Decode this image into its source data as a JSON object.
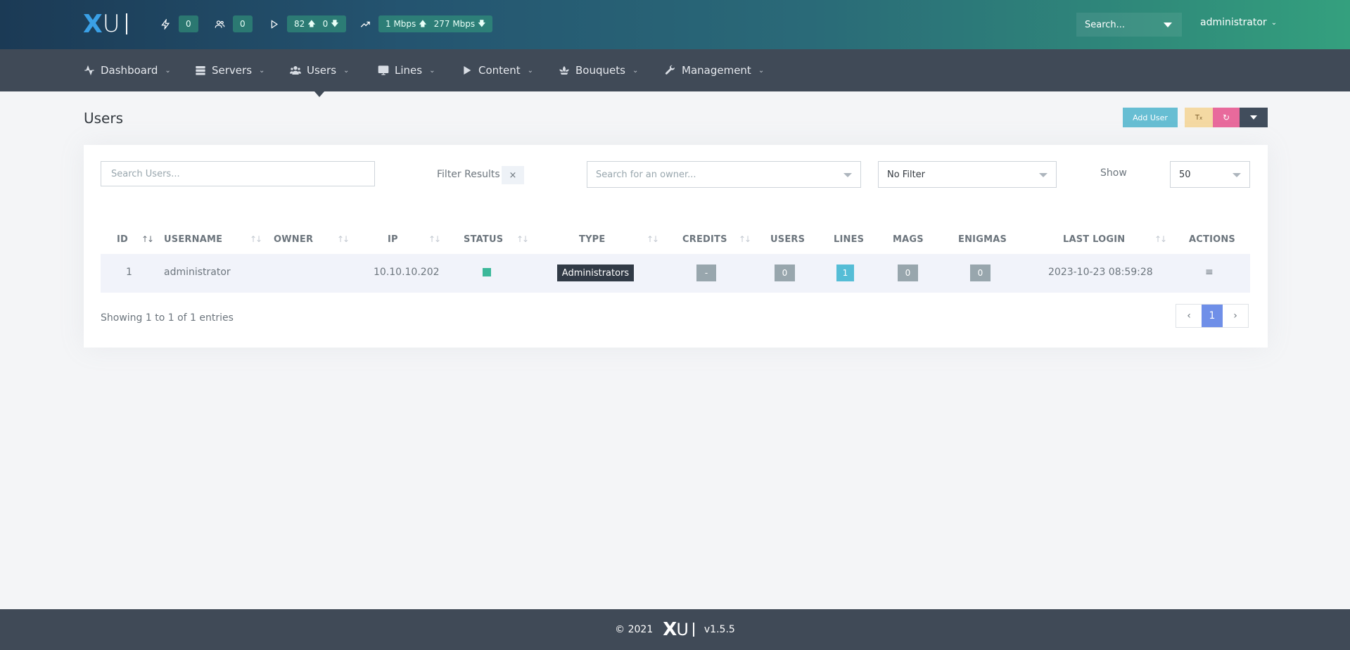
{
  "header": {
    "logo": {
      "x": "X",
      "u": "U"
    },
    "stats": {
      "connections": "0",
      "online_users": "0",
      "streams_up": "82",
      "streams_down": "0",
      "bandwidth_up": "1 Mbps",
      "bandwidth_down": "277 Mbps"
    },
    "search_placeholder": "Search...",
    "user": "administrator"
  },
  "nav": {
    "items": [
      {
        "label": "Dashboard",
        "icon": "activity-icon"
      },
      {
        "label": "Servers",
        "icon": "server-icon"
      },
      {
        "label": "Users",
        "icon": "users-icon"
      },
      {
        "label": "Lines",
        "icon": "monitor-icon"
      },
      {
        "label": "Content",
        "icon": "play-icon"
      },
      {
        "label": "Bouquets",
        "icon": "flower-icon"
      },
      {
        "label": "Management",
        "icon": "wrench-icon"
      }
    ],
    "active": "Users"
  },
  "page": {
    "title": "Users",
    "add_user_label": "Add User"
  },
  "filters": {
    "search_placeholder": "Search Users...",
    "filter_results_label": "Filter Results",
    "clear_label": "×",
    "owner_placeholder": "Search for an owner...",
    "status_filter": "No Filter",
    "show_label": "Show",
    "show_value": "50"
  },
  "table": {
    "columns": [
      "ID",
      "USERNAME",
      "OWNER",
      "IP",
      "STATUS",
      "TYPE",
      "CREDITS",
      "USERS",
      "LINES",
      "MAGS",
      "ENIGMAS",
      "LAST LOGIN",
      "ACTIONS"
    ],
    "rows": [
      {
        "id": "1",
        "username": "administrator",
        "owner": "",
        "ip": "10.10.10.202",
        "status": "active",
        "type": "Administrators",
        "credits": "-",
        "users": "0",
        "lines": "1",
        "mags": "0",
        "enigmas": "0",
        "last_login": "2023-10-23 08:59:28",
        "actions_icon": "≡"
      }
    ],
    "entries_text": "Showing 1 to 1 of 1 entries",
    "pagination": {
      "prev": "‹",
      "current": "1",
      "next": "›"
    }
  },
  "footer": {
    "copyright": "© 2021",
    "version": "v1.5.5"
  },
  "colors": {
    "nav_bg": "#404a57",
    "accent_teal": "#34a07e",
    "add_button": "#67bed3",
    "refresh_button": "#e86a9c",
    "filter_button": "#f4d9a3",
    "status_active": "#3cb89a",
    "page_active": "#6f8fe8"
  }
}
